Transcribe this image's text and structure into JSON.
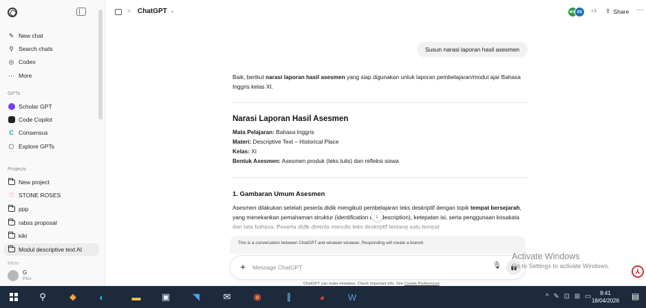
{
  "sidebar": {
    "items": [
      {
        "label": "New chat",
        "icon": "edit-icon"
      },
      {
        "label": "Search chats",
        "icon": "search-icon"
      },
      {
        "label": "Codex",
        "icon": "codex-icon"
      },
      {
        "label": "More",
        "icon": "more-icon"
      }
    ],
    "gpts_heading": "GPTs",
    "gpts": [
      {
        "label": "Scholar GPT",
        "icon": "scholar-gpt-icon",
        "color": "#7b3fe4"
      },
      {
        "label": "Code Copilot",
        "icon": "code-copilot-icon",
        "color": "#111111"
      },
      {
        "label": "Consensus",
        "icon": "consensus-icon",
        "color": "#1aa0a0"
      },
      {
        "label": "Explore GPTs",
        "icon": "explore-gpts-icon"
      }
    ],
    "projects_heading": "Projects",
    "projects": [
      {
        "label": "New project",
        "icon": "new-project-icon"
      },
      {
        "label": "STONE ROSES",
        "icon": "heart-icon",
        "color": "#e53935"
      },
      {
        "label": "ppp",
        "icon": "folder-icon"
      },
      {
        "label": "rabss proposal",
        "icon": "folder-icon"
      },
      {
        "label": "kiki",
        "icon": "folder-icon"
      },
      {
        "label": "Modul descriptive text AI",
        "icon": "folder-icon",
        "active": true
      }
    ],
    "more_label": "More",
    "user": {
      "name": "G",
      "plan": "Plus"
    }
  },
  "header": {
    "breadcrumb_separator": ">",
    "title": "ChatGPT",
    "avatar_1": "WW",
    "avatar_2": "RS",
    "avatar_more": "+1",
    "share_label": "Share",
    "more_label": "···"
  },
  "chat": {
    "user_message": "Susun narasi laporan hasil asesmen",
    "intro_1": "Baik, berikut ",
    "intro_bold": "narasi laporan hasil asesmen",
    "intro_2": " yang siap digunakan untuk laporan pembelajaran/modul ajar Bahasa Inggris kelas XI.",
    "heading": "Narasi Laporan Hasil Asesmen",
    "meta": [
      {
        "label": "Mata Pelajaran:",
        "value": " Bahasa Inggris"
      },
      {
        "label": "Materi:",
        "value": " Descriptive Text – Historical Place"
      },
      {
        "label": "Kelas:",
        "value": " XI"
      },
      {
        "label": "Bentuk Asesmen:",
        "value": " Asesmen produk (teks tulis) dan refleksi siswa"
      }
    ],
    "section_heading": "1. Gambaran Umum Asesmen",
    "section_text_1": "Asesmen dilakukan setelah peserta didik mengikuti pembelajaran teks deskriptif dengan topik ",
    "section_text_bold": "tempat bersejarah",
    "section_text_2": ", yang menekankan pemahaman struktur (identification dan description), ketepatan isi, serta penggunaan kosakata dan tata bahasa. Peserta didik diminta menulis teks deskriptif tentang satu tempat",
    "branch_note": "This is a conversation between ChatGPT and wirawan wirawan. Responding will create a branch.",
    "composer_placeholder": "Message ChatGPT",
    "disclaimer": "ChatGPT can make mistakes. Check important info. See ",
    "disclaimer_link": "Cookie Preferences",
    "disclaimer_end": "."
  },
  "watermark": {
    "line1": "Activate Windows",
    "line2": "Go to Settings to activate Windows."
  },
  "taskbar": {
    "apps": [
      "search-icon",
      "app-icon",
      "edge-icon",
      "file-explorer-icon",
      "store-icon",
      "app-icon",
      "mail-icon",
      "firefox-icon",
      "app-icon",
      "chrome-icon",
      "word-icon"
    ],
    "time": "8:41",
    "date": "18/04/2026"
  }
}
